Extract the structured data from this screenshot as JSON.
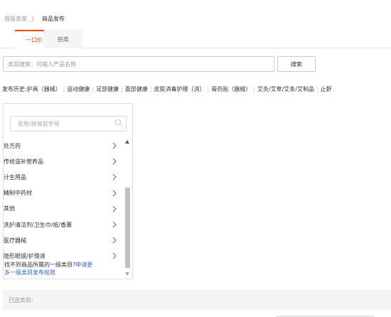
{
  "breadcrumb": {
    "parent": "我是卖家",
    "separator": "〉",
    "current": "商品发布"
  },
  "tabs": [
    {
      "label": "一口价",
      "active": true
    },
    {
      "label": "拍卖",
      "active": false
    }
  ],
  "search": {
    "placeholder": "类目搜索：可输入产品名称",
    "value": "",
    "button_label": "搜索"
  },
  "history": {
    "label": "发布历史:",
    "items": [
      "护具（器械）",
      "运动健康",
      "足部健康",
      "面部健康",
      "皮肤消毒护理（消）",
      "膏药贴（器械）",
      "艾灸/艾草/艾条/艾制品",
      "止鼾"
    ]
  },
  "category_panel": {
    "filter_placeholder": "名称/拼音首字母",
    "items": [
      "处方药",
      "传统滋补营养品",
      "计生用品",
      "精制中药材",
      "其他",
      "洗护清洁剂/卫生巾/纸/香薰",
      "医疗器械",
      "隐形眼镜/护理液"
    ],
    "footer_text": "找不到商品所属的一级类目?",
    "footer_link_1": "申请更",
    "footer_link_2": "多一级类目发布权限"
  },
  "selected": {
    "label": "已选类目:"
  },
  "colors": {
    "accent": "#ff4400",
    "link": "#3366cc"
  },
  "icons": {
    "filter": "search-icon",
    "chevron": "chevron-right-icon"
  }
}
